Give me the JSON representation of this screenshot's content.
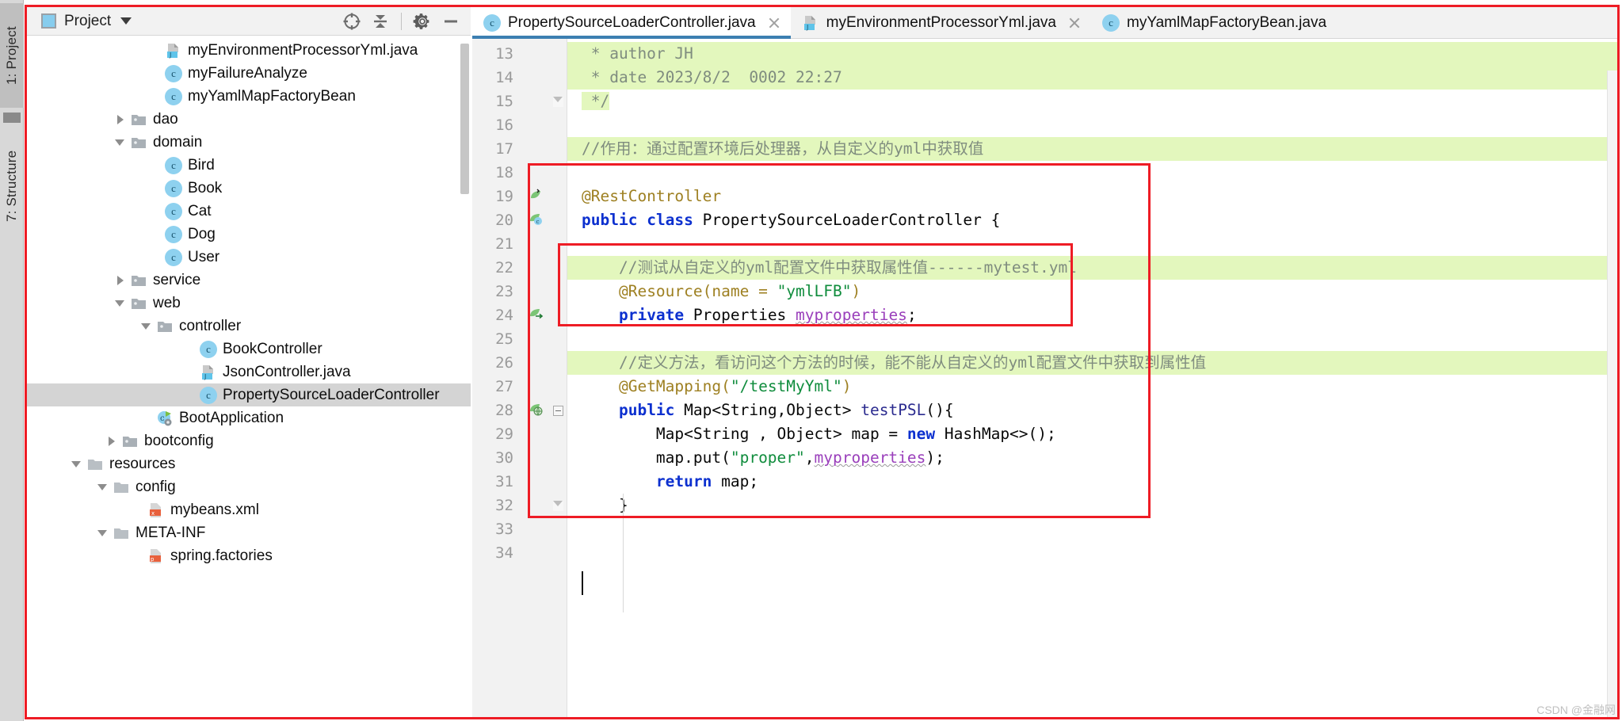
{
  "window": {
    "vertical_tabs": [
      {
        "label": "1: Project",
        "selected": true
      },
      {
        "label": "7: Structure",
        "selected": false
      }
    ]
  },
  "project_panel": {
    "title": "Project",
    "icon": "project-window-icon",
    "dropdown_icon": "chevron-down-icon",
    "toolbar": [
      {
        "name": "locate-file-button",
        "icon": "crosshair-icon"
      },
      {
        "name": "collapse-all-button",
        "icon": "collapse-all-icon"
      },
      {
        "name": "settings-button",
        "icon": "gear-icon"
      },
      {
        "name": "hide-button",
        "icon": "minimize-icon"
      }
    ],
    "tree": [
      {
        "label": "myEnvironmentProcessorYml.java",
        "icon": "java-file-icon",
        "indent": 7,
        "arrow": "none",
        "selected": false
      },
      {
        "label": "myFailureAnalyze",
        "icon": "class-icon",
        "indent": 7,
        "arrow": "none",
        "selected": false
      },
      {
        "label": "myYamlMapFactoryBean",
        "icon": "class-icon",
        "indent": 7,
        "arrow": "none",
        "selected": false
      },
      {
        "label": "dao",
        "icon": "folder-icon",
        "indent": 5,
        "arrow": "closed",
        "selected": false
      },
      {
        "label": "domain",
        "icon": "folder-icon",
        "indent": 5,
        "arrow": "open",
        "selected": false
      },
      {
        "label": "Bird",
        "icon": "class-icon",
        "indent": 7,
        "arrow": "none",
        "selected": false
      },
      {
        "label": "Book",
        "icon": "class-icon",
        "indent": 7,
        "arrow": "none",
        "selected": false
      },
      {
        "label": "Cat",
        "icon": "class-icon",
        "indent": 7,
        "arrow": "none",
        "selected": false
      },
      {
        "label": "Dog",
        "icon": "class-icon",
        "indent": 7,
        "arrow": "none",
        "selected": false
      },
      {
        "label": "User",
        "icon": "class-icon",
        "indent": 7,
        "arrow": "none",
        "selected": false
      },
      {
        "label": "service",
        "icon": "folder-icon",
        "indent": 5,
        "arrow": "closed",
        "selected": false
      },
      {
        "label": "web",
        "icon": "folder-icon",
        "indent": 5,
        "arrow": "open",
        "selected": false
      },
      {
        "label": "controller",
        "icon": "folder-icon",
        "indent": 6.5,
        "arrow": "open",
        "selected": false
      },
      {
        "label": "BookController",
        "icon": "class-icon",
        "indent": 9,
        "arrow": "none",
        "selected": false
      },
      {
        "label": "JsonController.java",
        "icon": "java-file-icon",
        "indent": 9,
        "arrow": "none",
        "selected": false
      },
      {
        "label": "PropertySourceLoaderController",
        "icon": "class-icon",
        "indent": 9,
        "arrow": "none",
        "selected": true
      },
      {
        "label": "BootApplication",
        "icon": "spring-boot-icon",
        "indent": 6.5,
        "arrow": "none",
        "selected": false
      },
      {
        "label": "bootconfig",
        "icon": "folder-icon",
        "indent": 4.5,
        "arrow": "closed",
        "selected": false
      },
      {
        "label": "resources",
        "icon": "resources-folder-icon",
        "indent": 2.5,
        "arrow": "open",
        "selected": false
      },
      {
        "label": "config",
        "icon": "folder-plain-icon",
        "indent": 4,
        "arrow": "open",
        "selected": false
      },
      {
        "label": "mybeans.xml",
        "icon": "xml-file-icon",
        "indent": 6,
        "arrow": "none",
        "selected": false
      },
      {
        "label": "META-INF",
        "icon": "folder-plain-icon",
        "indent": 4,
        "arrow": "open",
        "selected": false
      },
      {
        "label": "spring.factories",
        "icon": "properties-file-icon",
        "indent": 6,
        "arrow": "none",
        "selected": false
      }
    ]
  },
  "editor": {
    "tabs": [
      {
        "label": "PropertySourceLoaderController.java",
        "icon": "class-icon",
        "active": true,
        "closable": true
      },
      {
        "label": "myEnvironmentProcessorYml.java",
        "icon": "java-file-icon",
        "active": false,
        "closable": true
      },
      {
        "label": "myYamlMapFactoryBean.java",
        "icon": "class-icon",
        "active": false,
        "closable": false
      }
    ],
    "first_line_number": 13,
    "lines": [
      {
        "n": 13,
        "highlight": true,
        "gutter_icon": "",
        "fold": "",
        "text": " * author JH"
      },
      {
        "n": 14,
        "highlight": true,
        "gutter_icon": "",
        "fold": "",
        "text": " * date 2023/8/2  0002 22:27"
      },
      {
        "n": 15,
        "highlight": "partial",
        "gutter_icon": "",
        "fold": "fold-end",
        "text": " */"
      },
      {
        "n": 16,
        "highlight": false,
        "gutter_icon": "",
        "fold": "",
        "text": ""
      },
      {
        "n": 17,
        "highlight": true,
        "gutter_icon": "",
        "fold": "",
        "text": "//作用：通过配置环境后处理器，从自定义的yml中获取值"
      },
      {
        "n": 18,
        "highlight": false,
        "gutter_icon": "",
        "fold": "",
        "text": ""
      },
      {
        "n": 19,
        "highlight": false,
        "gutter_icon": "bean-icon",
        "fold": "",
        "text": "@RestController"
      },
      {
        "n": 20,
        "highlight": false,
        "gutter_icon": "bean-class-icon",
        "fold": "",
        "text": "public class PropertySourceLoaderController {"
      },
      {
        "n": 21,
        "highlight": false,
        "gutter_icon": "",
        "fold": "",
        "text": ""
      },
      {
        "n": 22,
        "highlight": true,
        "gutter_icon": "",
        "fold": "",
        "text": "    //测试从自定义的yml配置文件中获取属性值------mytest.yml"
      },
      {
        "n": 23,
        "highlight": false,
        "gutter_icon": "",
        "fold": "",
        "text": "    @Resource(name = \"ymlLFB\")"
      },
      {
        "n": 24,
        "highlight": false,
        "gutter_icon": "autowired-icon",
        "fold": "",
        "text": "    private Properties myproperties;"
      },
      {
        "n": 25,
        "highlight": false,
        "gutter_icon": "",
        "fold": "",
        "text": ""
      },
      {
        "n": 26,
        "highlight": true,
        "gutter_icon": "",
        "fold": "",
        "text": "    //定义方法，看访问这个方法的时候，能不能从自定义的yml配置文件中获取到属性值"
      },
      {
        "n": 27,
        "highlight": false,
        "gutter_icon": "",
        "fold": "",
        "text": "    @GetMapping(\"/testMyYml\")"
      },
      {
        "n": 28,
        "highlight": false,
        "gutter_icon": "url-mapping-icon",
        "fold": "fold-open",
        "text": "    public Map<String,Object> testPSL(){"
      },
      {
        "n": 29,
        "highlight": false,
        "gutter_icon": "",
        "fold": "",
        "text": "        Map<String , Object> map = new HashMap<>();"
      },
      {
        "n": 30,
        "highlight": false,
        "gutter_icon": "",
        "fold": "",
        "text": "        map.put(\"proper\",myproperties);"
      },
      {
        "n": 31,
        "highlight": false,
        "gutter_icon": "",
        "fold": "",
        "text": "        return map;"
      },
      {
        "n": 32,
        "highlight": false,
        "gutter_icon": "",
        "fold": "fold-end",
        "text": "    }"
      },
      {
        "n": 33,
        "highlight": false,
        "gutter_icon": "",
        "fold": "",
        "text": ""
      },
      {
        "n": 34,
        "highlight": false,
        "gutter_icon": "",
        "fold": "",
        "text": ""
      }
    ]
  },
  "annotations": {
    "outer_box": "outer-red-highlight-box",
    "inner_box_class_body": "class-body-red-highlight-box",
    "inner_box_resource_field": "resource-field-red-highlight-box",
    "color": "#ee1c25"
  },
  "watermark": "CSDN @金融网"
}
